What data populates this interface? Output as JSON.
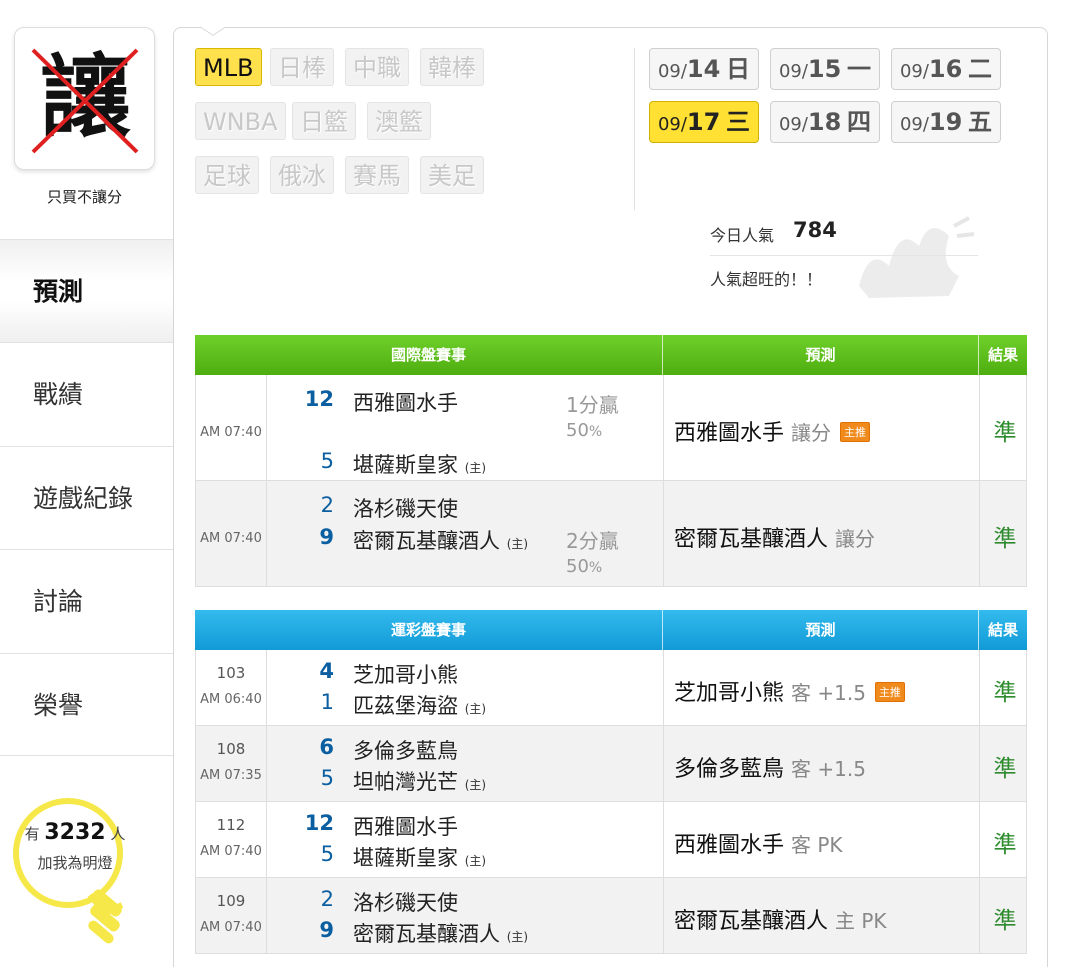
{
  "sidebar": {
    "logo_char": "讓",
    "logo_caption": "只買不讓分",
    "nav": [
      {
        "label": "預測"
      },
      {
        "label": "戰績"
      },
      {
        "label": "遊戲紀錄"
      },
      {
        "label": "討論"
      },
      {
        "label": "榮譽"
      }
    ],
    "fans": {
      "prefix": "有",
      "count": "3232",
      "suffix": "人",
      "line2": "加我為明燈"
    }
  },
  "leagues": [
    "MLB",
    "日棒",
    "中職",
    "韓棒",
    "WNBA",
    "日籃",
    "澳籃",
    "足球",
    "俄冰",
    "賽馬",
    "美足"
  ],
  "active_league": "MLB",
  "dates": [
    {
      "md": "09/",
      "day": "14",
      "wd": "日"
    },
    {
      "md": "09/",
      "day": "15",
      "wd": "一"
    },
    {
      "md": "09/",
      "day": "16",
      "wd": "二"
    },
    {
      "md": "09/",
      "day": "17",
      "wd": "三"
    },
    {
      "md": "09/",
      "day": "18",
      "wd": "四"
    },
    {
      "md": "09/",
      "day": "19",
      "wd": "五"
    }
  ],
  "active_date": "17",
  "popularity": {
    "label": "今日人氣",
    "value": "784",
    "message": "人氣超旺的！！"
  },
  "intl": {
    "headers": {
      "match": "國際盤賽事",
      "pred": "預測",
      "result": "結果"
    },
    "rows": [
      {
        "time": "AM 07:40",
        "away_score": "12",
        "away": "西雅圖水手",
        "home_score": "5",
        "home": "堪薩斯皇家",
        "home_tag": "(主)",
        "win": "1分贏",
        "pct": "50",
        "pct_unit": "%",
        "pred_team": "西雅圖水手",
        "pred_type": "讓分",
        "badge": "主推",
        "result": "準"
      },
      {
        "time": "AM 07:40",
        "away_score": "2",
        "away": "洛杉磯天使",
        "home_score": "9",
        "home": "密爾瓦基釀酒人",
        "home_tag": "(主)",
        "win": "2分贏",
        "pct": "50",
        "pct_unit": "%",
        "pred_team": "密爾瓦基釀酒人",
        "pred_type": "讓分",
        "result": "準"
      }
    ]
  },
  "lottery": {
    "headers": {
      "match": "運彩盤賽事",
      "pred": "預測",
      "result": "結果"
    },
    "rows": [
      {
        "no": "103",
        "time": "AM 06:40",
        "away_score": "4",
        "away": "芝加哥小熊",
        "home_score": "1",
        "home": "匹茲堡海盜",
        "home_tag": "(主)",
        "pred_team": "芝加哥小熊",
        "pred_type": "客 +1.5",
        "badge": "主推",
        "result": "準"
      },
      {
        "no": "108",
        "time": "AM 07:35",
        "away_score": "6",
        "away": "多倫多藍鳥",
        "home_score": "5",
        "home": "坦帕灣光芒",
        "home_tag": "(主)",
        "pred_team": "多倫多藍鳥",
        "pred_type": "客 +1.5",
        "result": "準"
      },
      {
        "no": "112",
        "time": "AM 07:40",
        "away_score": "12",
        "away": "西雅圖水手",
        "home_score": "5",
        "home": "堪薩斯皇家",
        "home_tag": "(主)",
        "pred_team": "西雅圖水手",
        "pred_type": "客 PK",
        "result": "準"
      },
      {
        "no": "109",
        "time": "AM 07:40",
        "away_score": "2",
        "away": "洛杉磯天使",
        "home_score": "9",
        "home": "密爾瓦基釀酒人",
        "home_tag": "(主)",
        "pred_team": "密爾瓦基釀酒人",
        "pred_type": "主 PK",
        "result": "準"
      }
    ]
  },
  "colors": {
    "accent_yellow": "#ffe033",
    "green_header": "#5cbd1c",
    "blue_header": "#1aa6e0",
    "result_green": "#2e8b2e",
    "score_blue": "#0b5fa0"
  }
}
